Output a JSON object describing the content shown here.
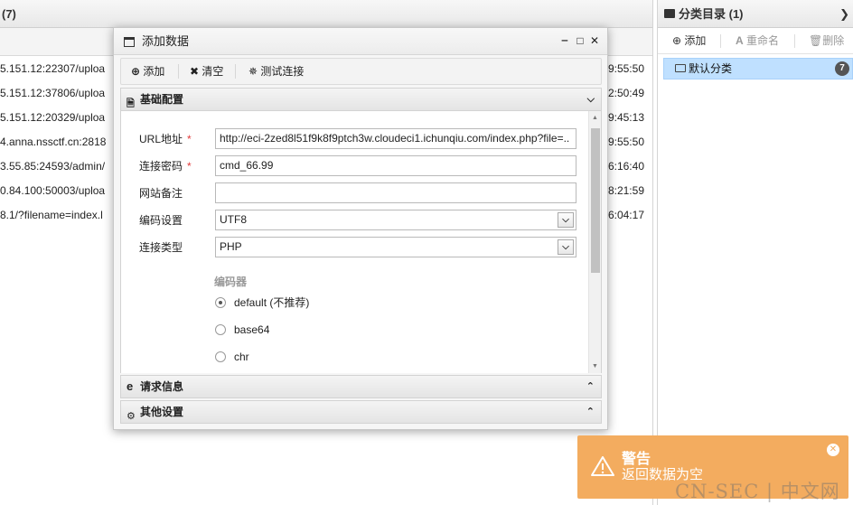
{
  "bg_list": {
    "header_title": "(7)",
    "rows": [
      {
        "url": "5.151.12:22307/uploa",
        "time": "9:55:50"
      },
      {
        "url": "5.151.12:37806/uploa",
        "time": "2:50:49"
      },
      {
        "url": "5.151.12:20329/uploa",
        "time": "9:45:13"
      },
      {
        "url": "4.anna.nssctf.cn:2818",
        "time": "9:55:50"
      },
      {
        "url": "3.55.85:24593/admin/",
        "time": "6:16:40"
      },
      {
        "url": "0.84.100:50003/uploa",
        "time": "8:21:59"
      },
      {
        "url": "8.1/?filename=index.l",
        "time": "6:04:17"
      }
    ]
  },
  "category_panel": {
    "title": "分类目录 (1)",
    "toolbar": {
      "add": "添加",
      "rename": "重命名",
      "delete": "删除"
    },
    "items": [
      {
        "label": "默认分类",
        "count": "7"
      }
    ]
  },
  "dialog": {
    "title": "添加数据",
    "toolbar": {
      "add": "添加",
      "clear": "清空",
      "test": "测试连接"
    },
    "sections": {
      "basic": "基础配置",
      "request": "请求信息",
      "other": "其他设置"
    },
    "fields": {
      "url_label": "URL地址",
      "url_value": "http://eci-2zed8l51f9k8f9ptch3w.cloudeci1.ichunqiu.com/index.php?file=..",
      "password_label": "连接密码",
      "password_value": "cmd_66.99",
      "note_label": "网站备注",
      "note_value": "",
      "encoding_label": "编码设置",
      "encoding_value": "UTF8",
      "type_label": "连接类型",
      "type_value": "PHP",
      "required_mark": "*"
    },
    "encoder": {
      "label": "编码器",
      "options": [
        "default (不推荐)",
        "base64",
        "chr"
      ],
      "selected": "default (不推荐)"
    }
  },
  "toast": {
    "title": "警告",
    "message": "返回数据为空",
    "color": "#f3ac5f"
  },
  "watermark": "CN-SEC | 中文网"
}
